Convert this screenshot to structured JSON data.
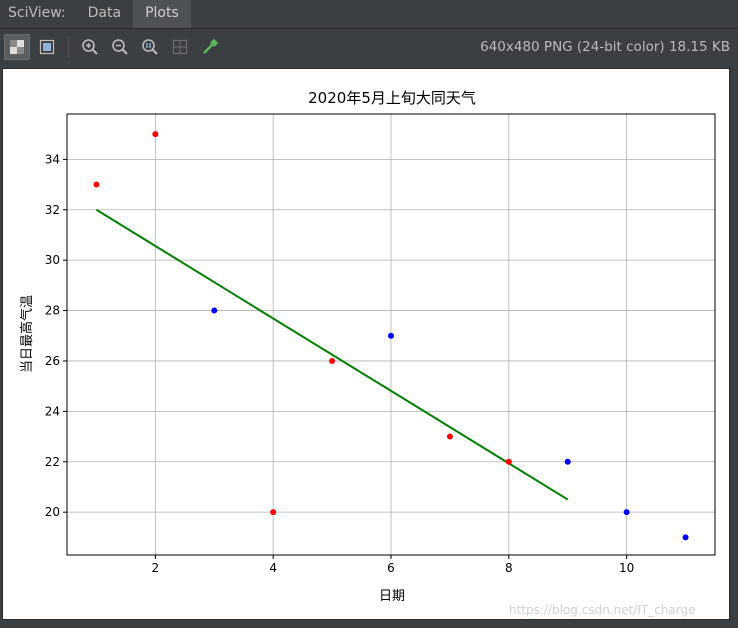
{
  "app": {
    "name": "SciView:"
  },
  "tabs": [
    {
      "label": "Data",
      "active": false
    },
    {
      "label": "Plots",
      "active": true
    }
  ],
  "toolbar": {
    "buttons": [
      {
        "icon": "checkerboard-background-icon",
        "active": true
      },
      {
        "icon": "fit-frame-icon",
        "active": false
      },
      {
        "icon": "zoom-in-icon",
        "active": false
      },
      {
        "icon": "zoom-out-icon",
        "active": false
      },
      {
        "icon": "actual-size-icon",
        "active": false
      },
      {
        "icon": "grid-toggle-icon",
        "active": false
      },
      {
        "icon": "color-picker-icon",
        "active": false
      }
    ],
    "image_info": "640x480 PNG (24-bit color) 18.15 KB"
  },
  "watermark": "https://blog.csdn.net/IT_charge",
  "chart_data": {
    "type": "scatter",
    "title": "2020年5月上旬大同天气",
    "xlabel": "日期",
    "ylabel": "当日最高气温",
    "xlim": [
      0.5,
      11.5
    ],
    "ylim": [
      18.3,
      35.8
    ],
    "xticks": [
      2,
      4,
      6,
      8,
      10
    ],
    "yticks": [
      20,
      22,
      24,
      26,
      28,
      30,
      32,
      34
    ],
    "grid": true,
    "colors": {
      "red": "#ff0000",
      "blue": "#0000ff",
      "line": "#008000"
    },
    "points": [
      {
        "x": 1,
        "y": 33,
        "color": "red"
      },
      {
        "x": 2,
        "y": 35,
        "color": "red"
      },
      {
        "x": 3,
        "y": 28,
        "color": "blue"
      },
      {
        "x": 4,
        "y": 20,
        "color": "red"
      },
      {
        "x": 5,
        "y": 26,
        "color": "red"
      },
      {
        "x": 6,
        "y": 27,
        "color": "blue"
      },
      {
        "x": 7,
        "y": 23,
        "color": "red"
      },
      {
        "x": 8,
        "y": 22,
        "color": "red"
      },
      {
        "x": 9,
        "y": 22,
        "color": "blue"
      },
      {
        "x": 10,
        "y": 20,
        "color": "blue"
      },
      {
        "x": 11,
        "y": 19,
        "color": "blue"
      }
    ],
    "fit_line": {
      "x": [
        1,
        9
      ],
      "y": [
        32.0,
        20.5
      ]
    }
  }
}
